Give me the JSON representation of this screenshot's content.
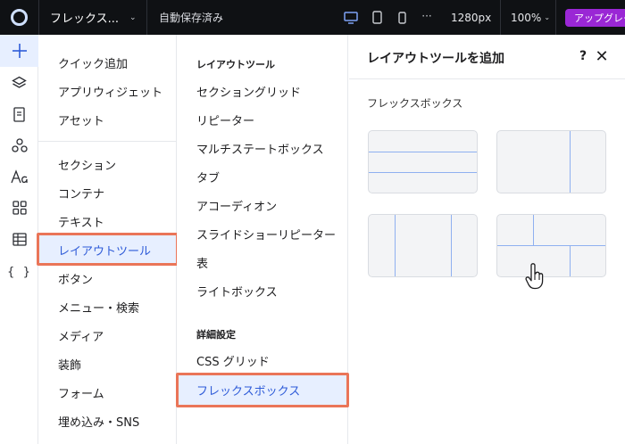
{
  "topbar": {
    "site_name": "フレックス...",
    "save_status": "自動保存済み",
    "width_value": "1280px",
    "zoom_value": "100%",
    "upgrade_label": "アップグレー",
    "more_icon": "ellipsis-icon"
  },
  "rail": {
    "items": [
      {
        "icon": "plus-icon"
      },
      {
        "icon": "layers-icon"
      },
      {
        "icon": "page-icon"
      },
      {
        "icon": "apps-icon"
      },
      {
        "icon": "typography-icon"
      },
      {
        "icon": "grid-icon"
      },
      {
        "icon": "table-icon"
      },
      {
        "icon": "code-braces-icon",
        "label": "{ }"
      }
    ]
  },
  "categories": {
    "top": [
      "クイック追加",
      "アプリウィジェット",
      "アセット"
    ],
    "main": [
      "セクション",
      "コンテナ",
      "テキスト",
      "レイアウトツール",
      "ボタン",
      "メニュー・検索",
      "メディア",
      "装飾",
      "フォーム",
      "埋め込み・SNS"
    ],
    "selected": "レイアウトツール"
  },
  "subcategories": {
    "heading1": "レイアウトツール",
    "items1": [
      "セクショングリッド",
      "リピーター",
      "マルチステートボックス",
      "タブ",
      "アコーディオン",
      "スライドショーリピーター",
      "表",
      "ライトボックス"
    ],
    "heading2": "詳細設定",
    "items2": [
      "CSS グリッド",
      "フレックスボックス"
    ],
    "selected": "フレックスボックス"
  },
  "panel": {
    "title": "レイアウトツールを追加",
    "help_label": "?",
    "close_label": "✕",
    "section_label": "フレックスボックス",
    "presets": [
      "flex-rows-3",
      "flex-columns-2",
      "flex-columns-3",
      "flex-mixed"
    ]
  },
  "colors": {
    "accent": "#2e5bd8",
    "selected_bg": "#e7efff",
    "highlight": "#ea7558",
    "upgrade": "#9a27d5",
    "topbar": "#0f1114"
  }
}
